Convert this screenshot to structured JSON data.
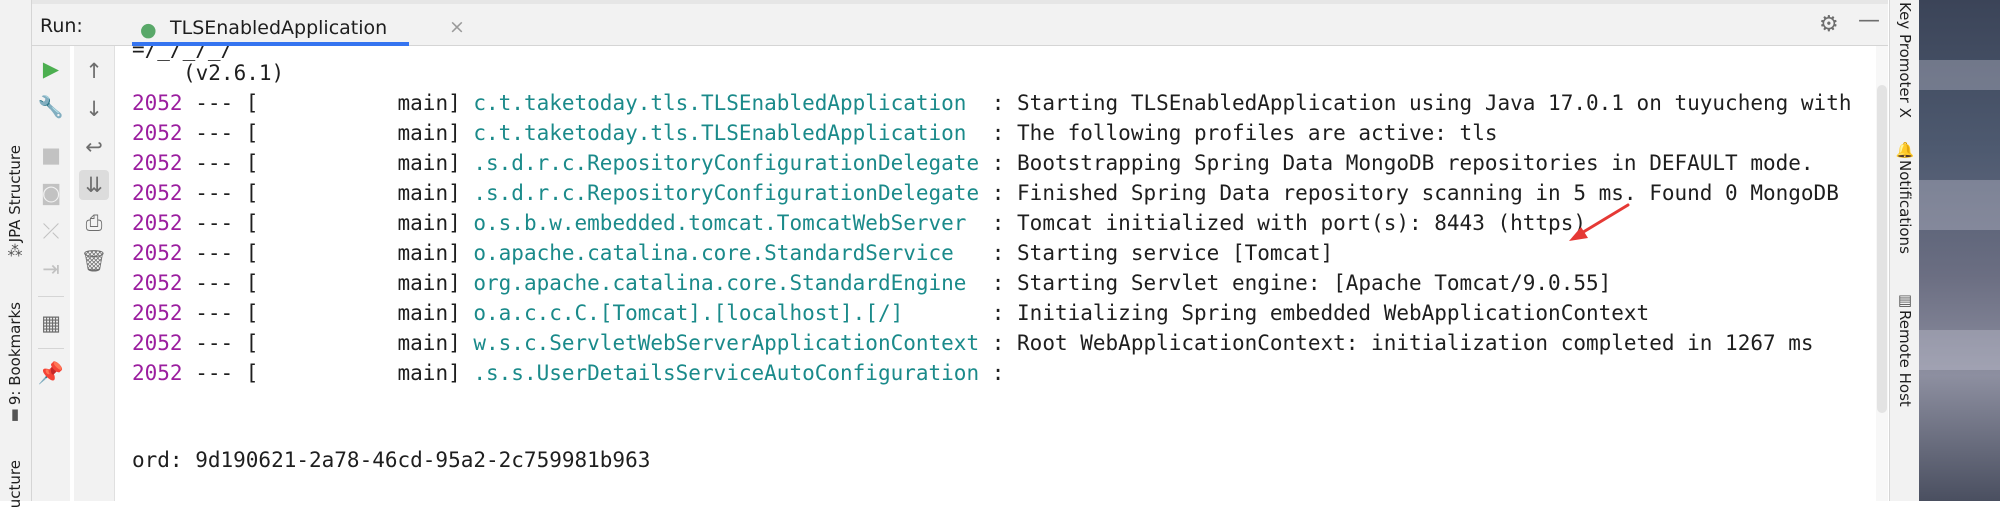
{
  "run_panel": {
    "run_label": "Run:",
    "tab_title": "TLSEnabledApplication",
    "tab_close": "×",
    "settings_icon": "gear-icon",
    "minimize_icon": "minimize-icon"
  },
  "left_sidebar": {
    "tabs": [
      {
        "label": "JPA Structure",
        "icon": "jpa-structure-icon"
      },
      {
        "label": "9: Bookmarks",
        "icon": "bookmark-icon"
      },
      {
        "label": "ucture"
      }
    ]
  },
  "right_sidebar": {
    "tabs": [
      {
        "label": "Key Promoter X"
      },
      {
        "label": "Notifications",
        "icon": "bell-icon"
      },
      {
        "label": "Remote Host",
        "icon": "remote-host-icon"
      }
    ]
  },
  "toolbar_left": [
    "rerun-icon",
    "wrench-icon",
    "stop-icon",
    "camera-icon",
    "exit-icon",
    "login-icon",
    "layout-icon",
    "pin-icon"
  ],
  "toolbar_right": [
    "up-arrow-icon",
    "down-arrow-icon",
    "soft-wrap-icon",
    "scroll-to-end-icon",
    "print-icon",
    "trash-icon"
  ],
  "console": {
    "banner_tail": "=/_/_/_/",
    "version": "(v2.6.1)",
    "log_lines": [
      {
        "pid": "2052",
        "mid": " --- [           main] ",
        "logger": "c.t.taketoday.tls.TLSEnabledApplication ",
        "message": " : Starting TLSEnabledApplication using Java 17.0.1 on tuyucheng with"
      },
      {
        "pid": "2052",
        "mid": " --- [           main] ",
        "logger": "c.t.taketoday.tls.TLSEnabledApplication ",
        "message": " : The following profiles are active: tls"
      },
      {
        "pid": "2052",
        "mid": " --- [           main] ",
        "logger": ".s.d.r.c.RepositoryConfigurationDelegate",
        "message": " : Bootstrapping Spring Data MongoDB repositories in DEFAULT mode."
      },
      {
        "pid": "2052",
        "mid": " --- [           main] ",
        "logger": ".s.d.r.c.RepositoryConfigurationDelegate",
        "message": " : Finished Spring Data repository scanning in 5 ms. Found 0 MongoDB"
      },
      {
        "pid": "2052",
        "mid": " --- [           main] ",
        "logger": "o.s.b.w.embedded.tomcat.TomcatWebServer ",
        "message": " : Tomcat initialized with port(s): 8443 (https)"
      },
      {
        "pid": "2052",
        "mid": " --- [           main] ",
        "logger": "o.apache.catalina.core.StandardService  ",
        "message": " : Starting service [Tomcat]"
      },
      {
        "pid": "2052",
        "mid": " --- [           main] ",
        "logger": "org.apache.catalina.core.StandardEngine ",
        "message": " : Starting Servlet engine: [Apache Tomcat/9.0.55]"
      },
      {
        "pid": "2052",
        "mid": " --- [           main] ",
        "logger": "o.a.c.c.C.[Tomcat].[localhost].[/]      ",
        "message": " : Initializing Spring embedded WebApplicationContext"
      },
      {
        "pid": "2052",
        "mid": " --- [           main] ",
        "logger": "w.s.c.ServletWebServerApplicationContext",
        "message": " : Root WebApplicationContext: initialization completed in 1267 ms"
      },
      {
        "pid": "2052",
        "mid": " --- [           main] ",
        "logger": ".s.s.UserDetailsServiceAutoConfiguration",
        "message": " :"
      }
    ],
    "password_line": "ord: 9d190621-2a78-46cd-95a2-2c759981b963"
  },
  "colors": {
    "pid": "#9b1e9f",
    "logger": "#1a8a8a",
    "annotation_arrow": "#e53935",
    "tab_underline": "#3574f0"
  }
}
